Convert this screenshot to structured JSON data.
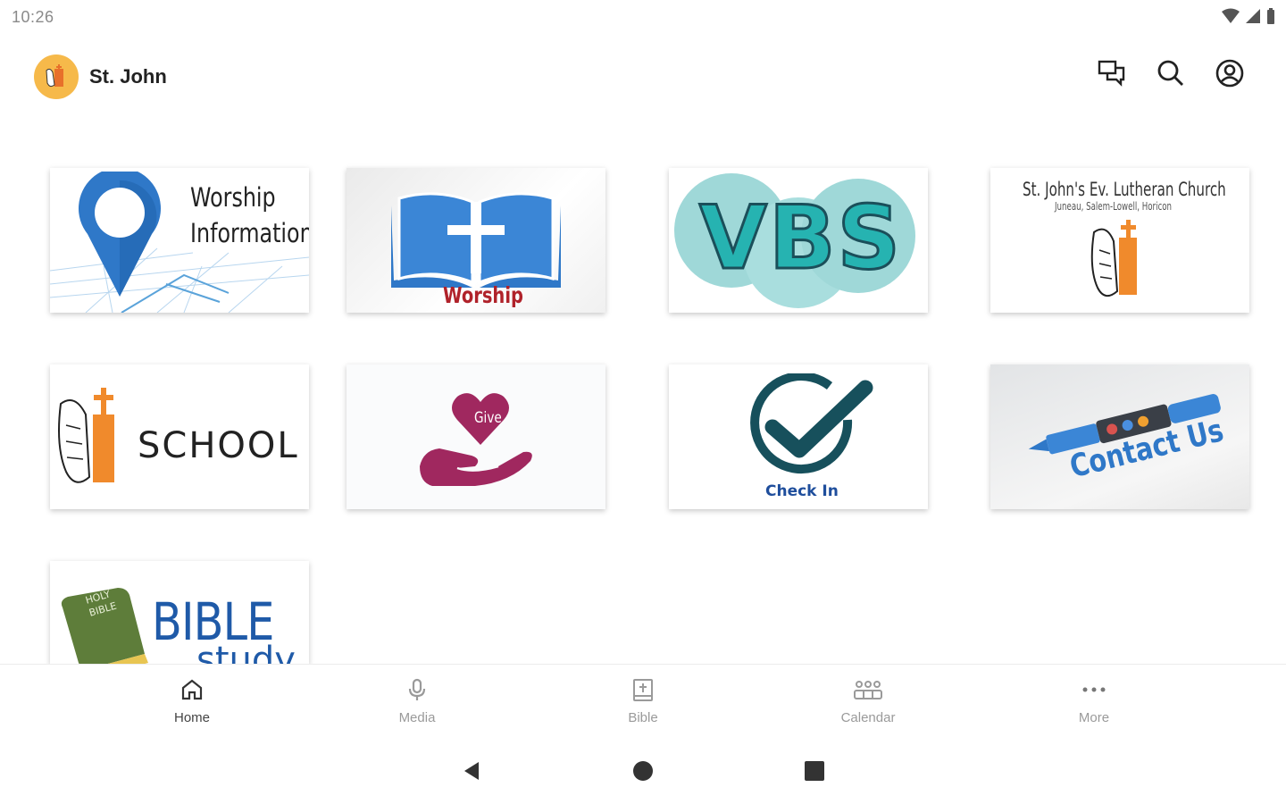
{
  "status_bar": {
    "time": "10:26"
  },
  "app_bar": {
    "title": "St. John"
  },
  "tiles": [
    {
      "line1": "Worship",
      "line2": "Information"
    },
    {
      "label": "Worship"
    },
    {
      "label": "VBS"
    },
    {
      "line1": "St. John's Ev. Lutheran Church",
      "line2": "Juneau, Salem-Lowell, Horicon"
    },
    {
      "label": "SCHOOL"
    },
    {
      "label": "Give"
    },
    {
      "label": "Check In"
    },
    {
      "label": "Contact Us"
    },
    {
      "line1": "HOLY",
      "line2": "BIBLE",
      "line3": "BIBLE",
      "line4": "study"
    }
  ],
  "bottom_nav": [
    {
      "label": "Home",
      "icon": "home-icon"
    },
    {
      "label": "Media",
      "icon": "microphone-icon"
    },
    {
      "label": "Bible",
      "icon": "bible-icon"
    },
    {
      "label": "Calendar",
      "icon": "calendar-icon"
    },
    {
      "label": "More",
      "icon": "more-icon"
    }
  ],
  "colors": {
    "brand": "#f6b94a",
    "accent_blue": "#2f78c8",
    "teal": "#26b3b1",
    "give": "#a0285f",
    "check": "#17505c"
  }
}
